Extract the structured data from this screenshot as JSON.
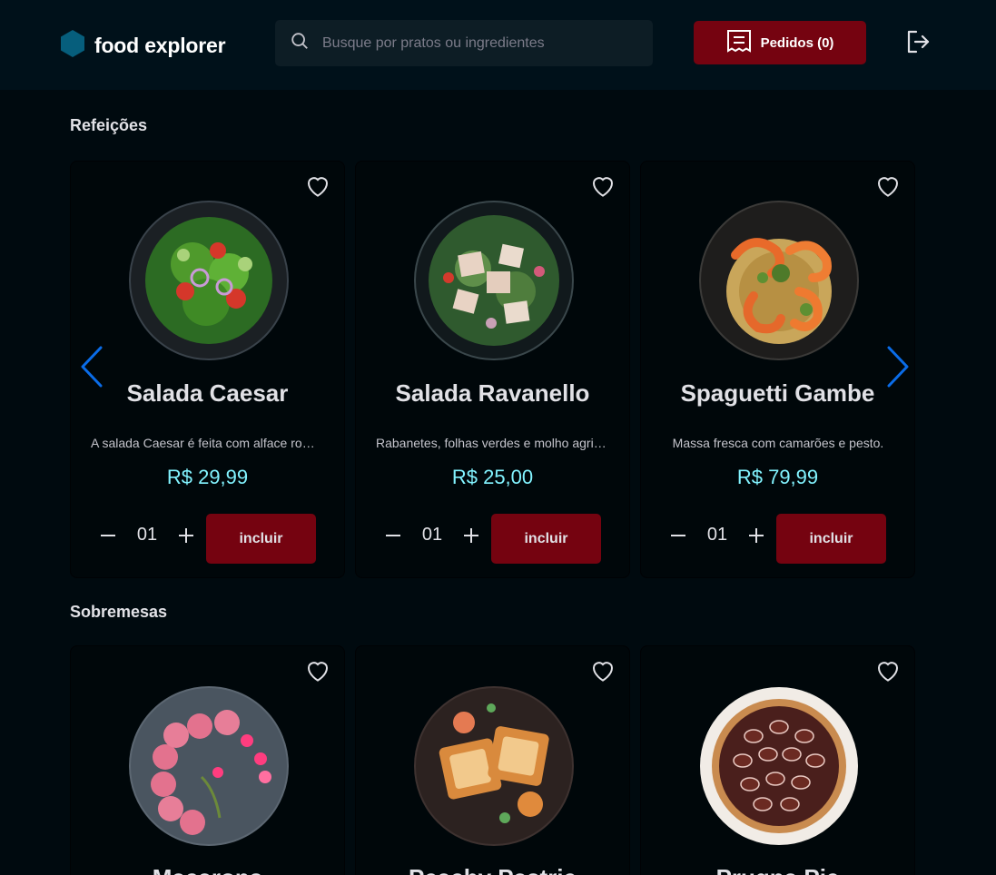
{
  "header": {
    "brand": "food explorer",
    "search_placeholder": "Busque por pratos ou ingredientes",
    "orders_label": "Pedidos (0)",
    "icons": {
      "brand": "hexagon-icon",
      "search": "search-icon",
      "orders": "receipt-icon",
      "logout": "sign-out-icon"
    }
  },
  "colors": {
    "background": "#000a0f",
    "header_bg": "#00111a",
    "accent": "#750310",
    "price": "#82f3ff",
    "brand_hexagon": "#065e7c",
    "arrow": "#0a6ce8"
  },
  "sections": [
    {
      "title": "Refeições",
      "dishes": [
        {
          "name": "Salada Caesar",
          "description": "A salada Caesar é feita com alface romana, croutons e molho",
          "price": "R$ 29,99",
          "qty": "01",
          "add_label": "incluir"
        },
        {
          "name": "Salada Ravanello",
          "description": "Rabanetes, folhas verdes e molho agridoce salpicados com gergelim",
          "price": "R$ 25,00",
          "qty": "01",
          "add_label": "incluir"
        },
        {
          "name": "Spaguetti Gambe",
          "description": "Massa fresca com camarões e pesto.",
          "price": "R$ 79,99",
          "qty": "01",
          "add_label": "incluir"
        }
      ]
    },
    {
      "title": "Sobremesas",
      "dishes": [
        {
          "name": "Macarons"
        },
        {
          "name": "Peachy Pastrie"
        },
        {
          "name": "Prugna Pie"
        }
      ]
    }
  ]
}
